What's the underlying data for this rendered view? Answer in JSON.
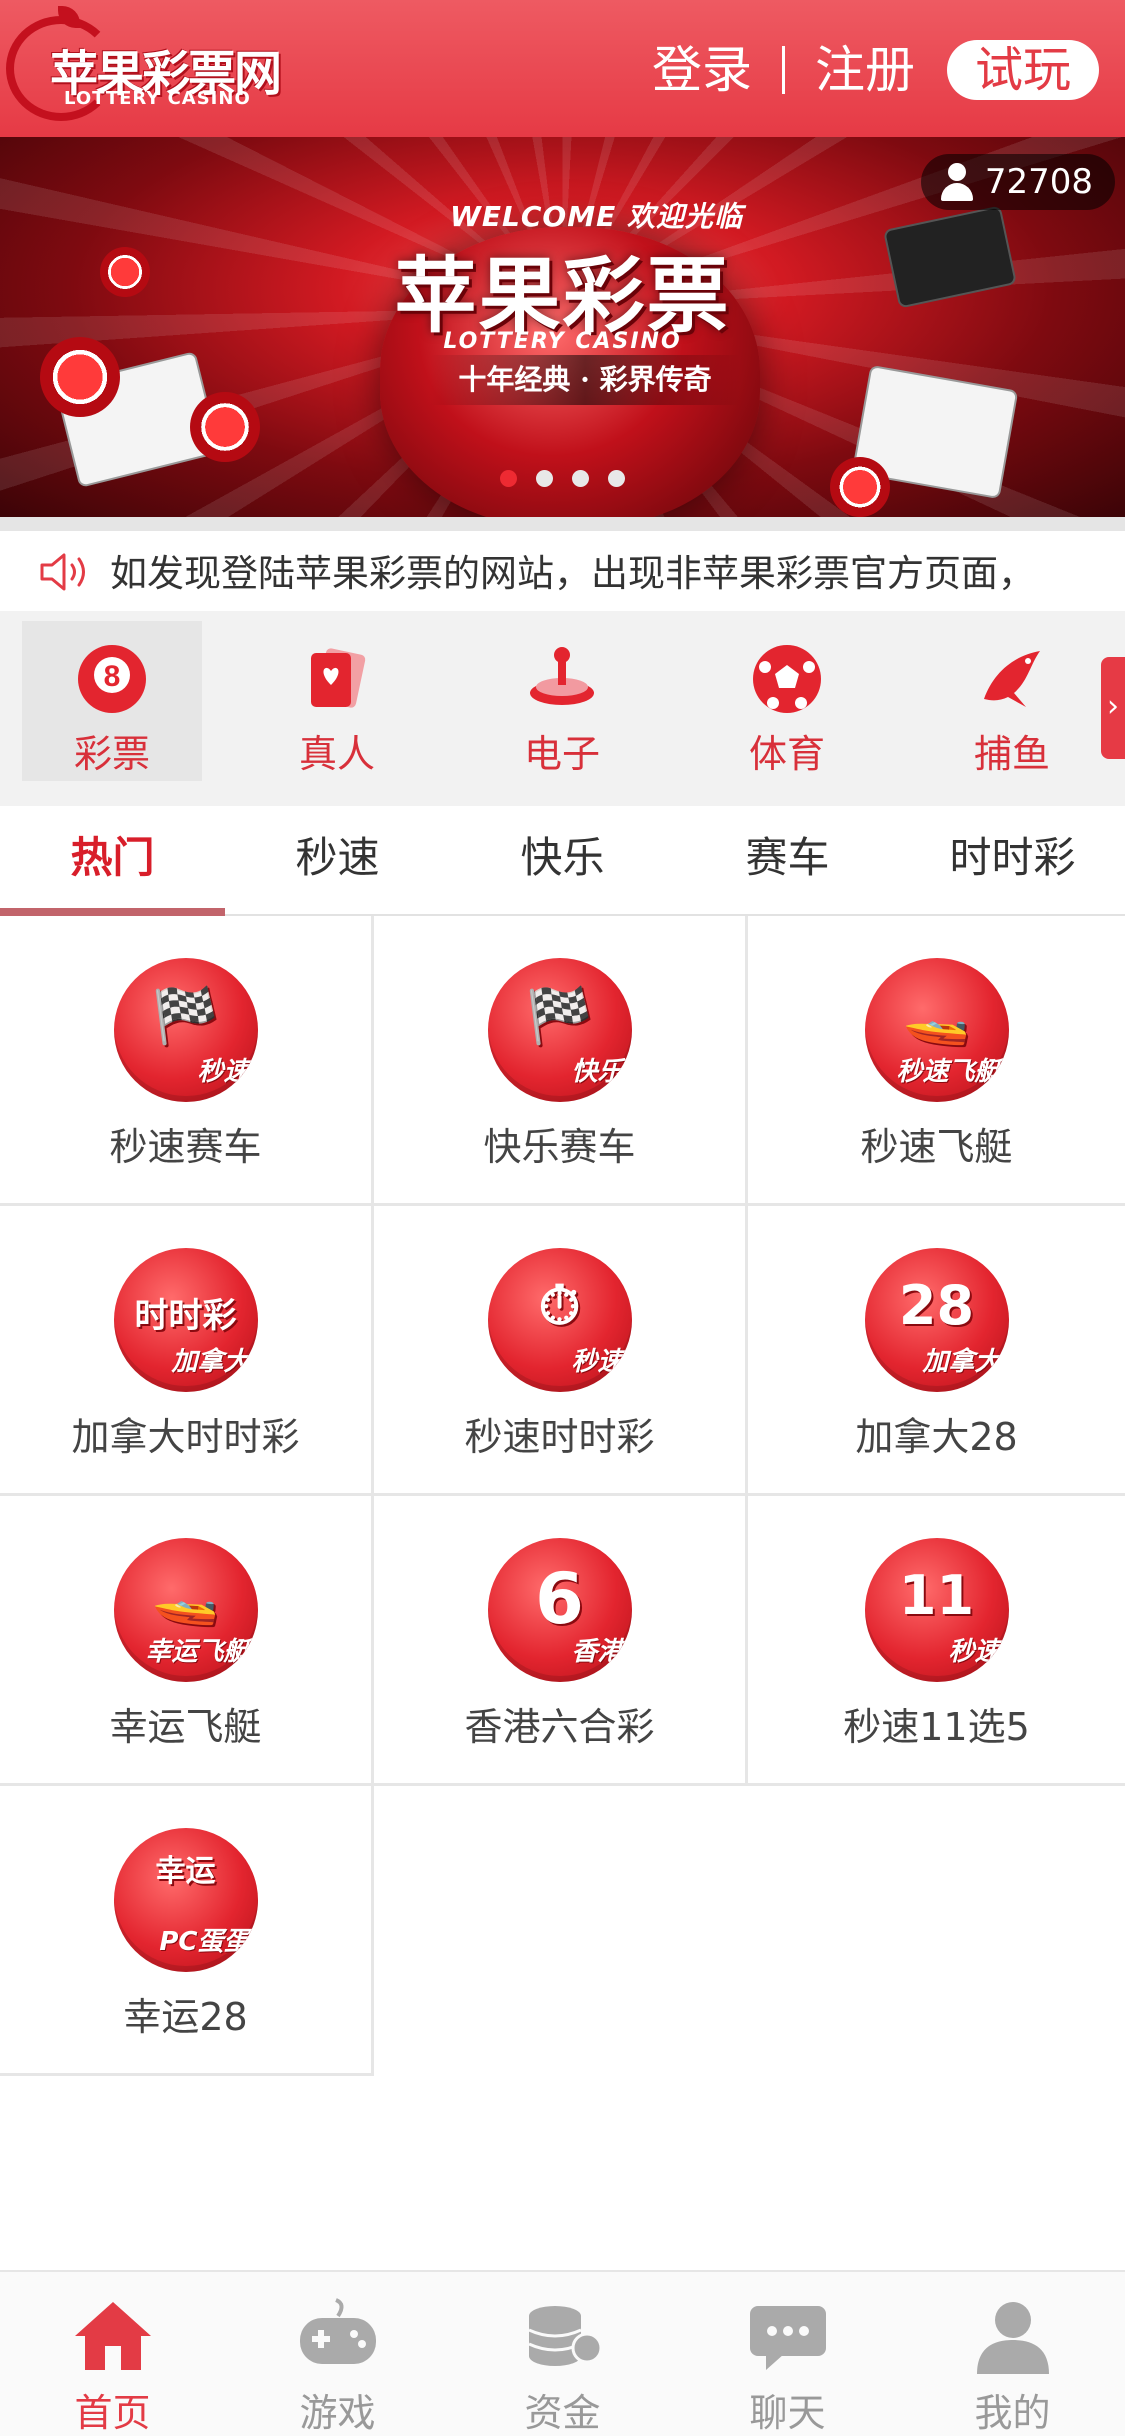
{
  "header": {
    "logo_title": "苹果彩票网",
    "logo_sub": "LOTTERY CASINO",
    "login": "登录",
    "register": "注册",
    "trial": "试玩"
  },
  "banner": {
    "welcome": "WELCOME 欢迎光临",
    "title": "苹果彩票",
    "casino": "LOTTERY CASINO",
    "slogan": "十年经典 · 彩界传奇",
    "visitor_count": "72708",
    "slides_total": 4,
    "slide_active": 1
  },
  "notice": {
    "text": "如发现登陆苹果彩票的网站，出现非苹果彩票官方页面，"
  },
  "categories": [
    {
      "label": "彩票",
      "icon": "lottery-ball-icon",
      "active": true
    },
    {
      "label": "真人",
      "icon": "cards-icon",
      "active": false
    },
    {
      "label": "电子",
      "icon": "slot-machine-icon",
      "active": false
    },
    {
      "label": "体育",
      "icon": "soccer-ball-icon",
      "active": false
    },
    {
      "label": "捕鱼",
      "icon": "fish-icon",
      "active": false
    }
  ],
  "subtabs": [
    {
      "label": "热门",
      "active": true
    },
    {
      "label": "秒速",
      "active": false
    },
    {
      "label": "快乐",
      "active": false
    },
    {
      "label": "赛车",
      "active": false
    },
    {
      "label": "时时彩",
      "active": false
    }
  ],
  "games": [
    {
      "label": "秒速赛车",
      "emblem": "🏁",
      "tag": "秒速",
      "icon": "race-car-icon"
    },
    {
      "label": "快乐赛车",
      "emblem": "🏁",
      "tag": "快乐",
      "icon": "race-car-icon"
    },
    {
      "label": "秒速飞艇",
      "emblem": "🚤",
      "tag": "秒速飞艇",
      "icon": "jet-ski-icon"
    },
    {
      "label": "加拿大时时彩",
      "emblem": "时时彩",
      "tag": "加拿大",
      "icon": "lottery-ball-icon"
    },
    {
      "label": "秒速时时彩",
      "emblem": "⏱",
      "tag": "秒速",
      "icon": "stopwatch-icon"
    },
    {
      "label": "加拿大28",
      "emblem": "28",
      "tag": "加拿大",
      "icon": "number-28-icon"
    },
    {
      "label": "幸运飞艇",
      "emblem": "🚤",
      "tag": "幸运飞艇",
      "icon": "jet-ski-icon"
    },
    {
      "label": "香港六合彩",
      "emblem": "6",
      "tag": "香港",
      "icon": "six-star-icon"
    },
    {
      "label": "秒速11选5",
      "emblem": "11",
      "tag": "秒速",
      "icon": "number-11-icon"
    },
    {
      "label": "幸运28",
      "emblem": "幸运",
      "tag": "PC蛋蛋",
      "icon": "pc-egg-icon"
    }
  ],
  "bottom_nav": [
    {
      "label": "首页",
      "icon": "home-icon",
      "active": true
    },
    {
      "label": "游戏",
      "icon": "gamepad-icon",
      "active": false
    },
    {
      "label": "资金",
      "icon": "coins-icon",
      "active": false
    },
    {
      "label": "聊天",
      "icon": "chat-icon",
      "active": false
    },
    {
      "label": "我的",
      "icon": "user-icon",
      "active": false
    }
  ],
  "colors": {
    "brand_red": "#e33b45",
    "active_red": "#d81e2a",
    "inactive_gray": "#999999"
  }
}
